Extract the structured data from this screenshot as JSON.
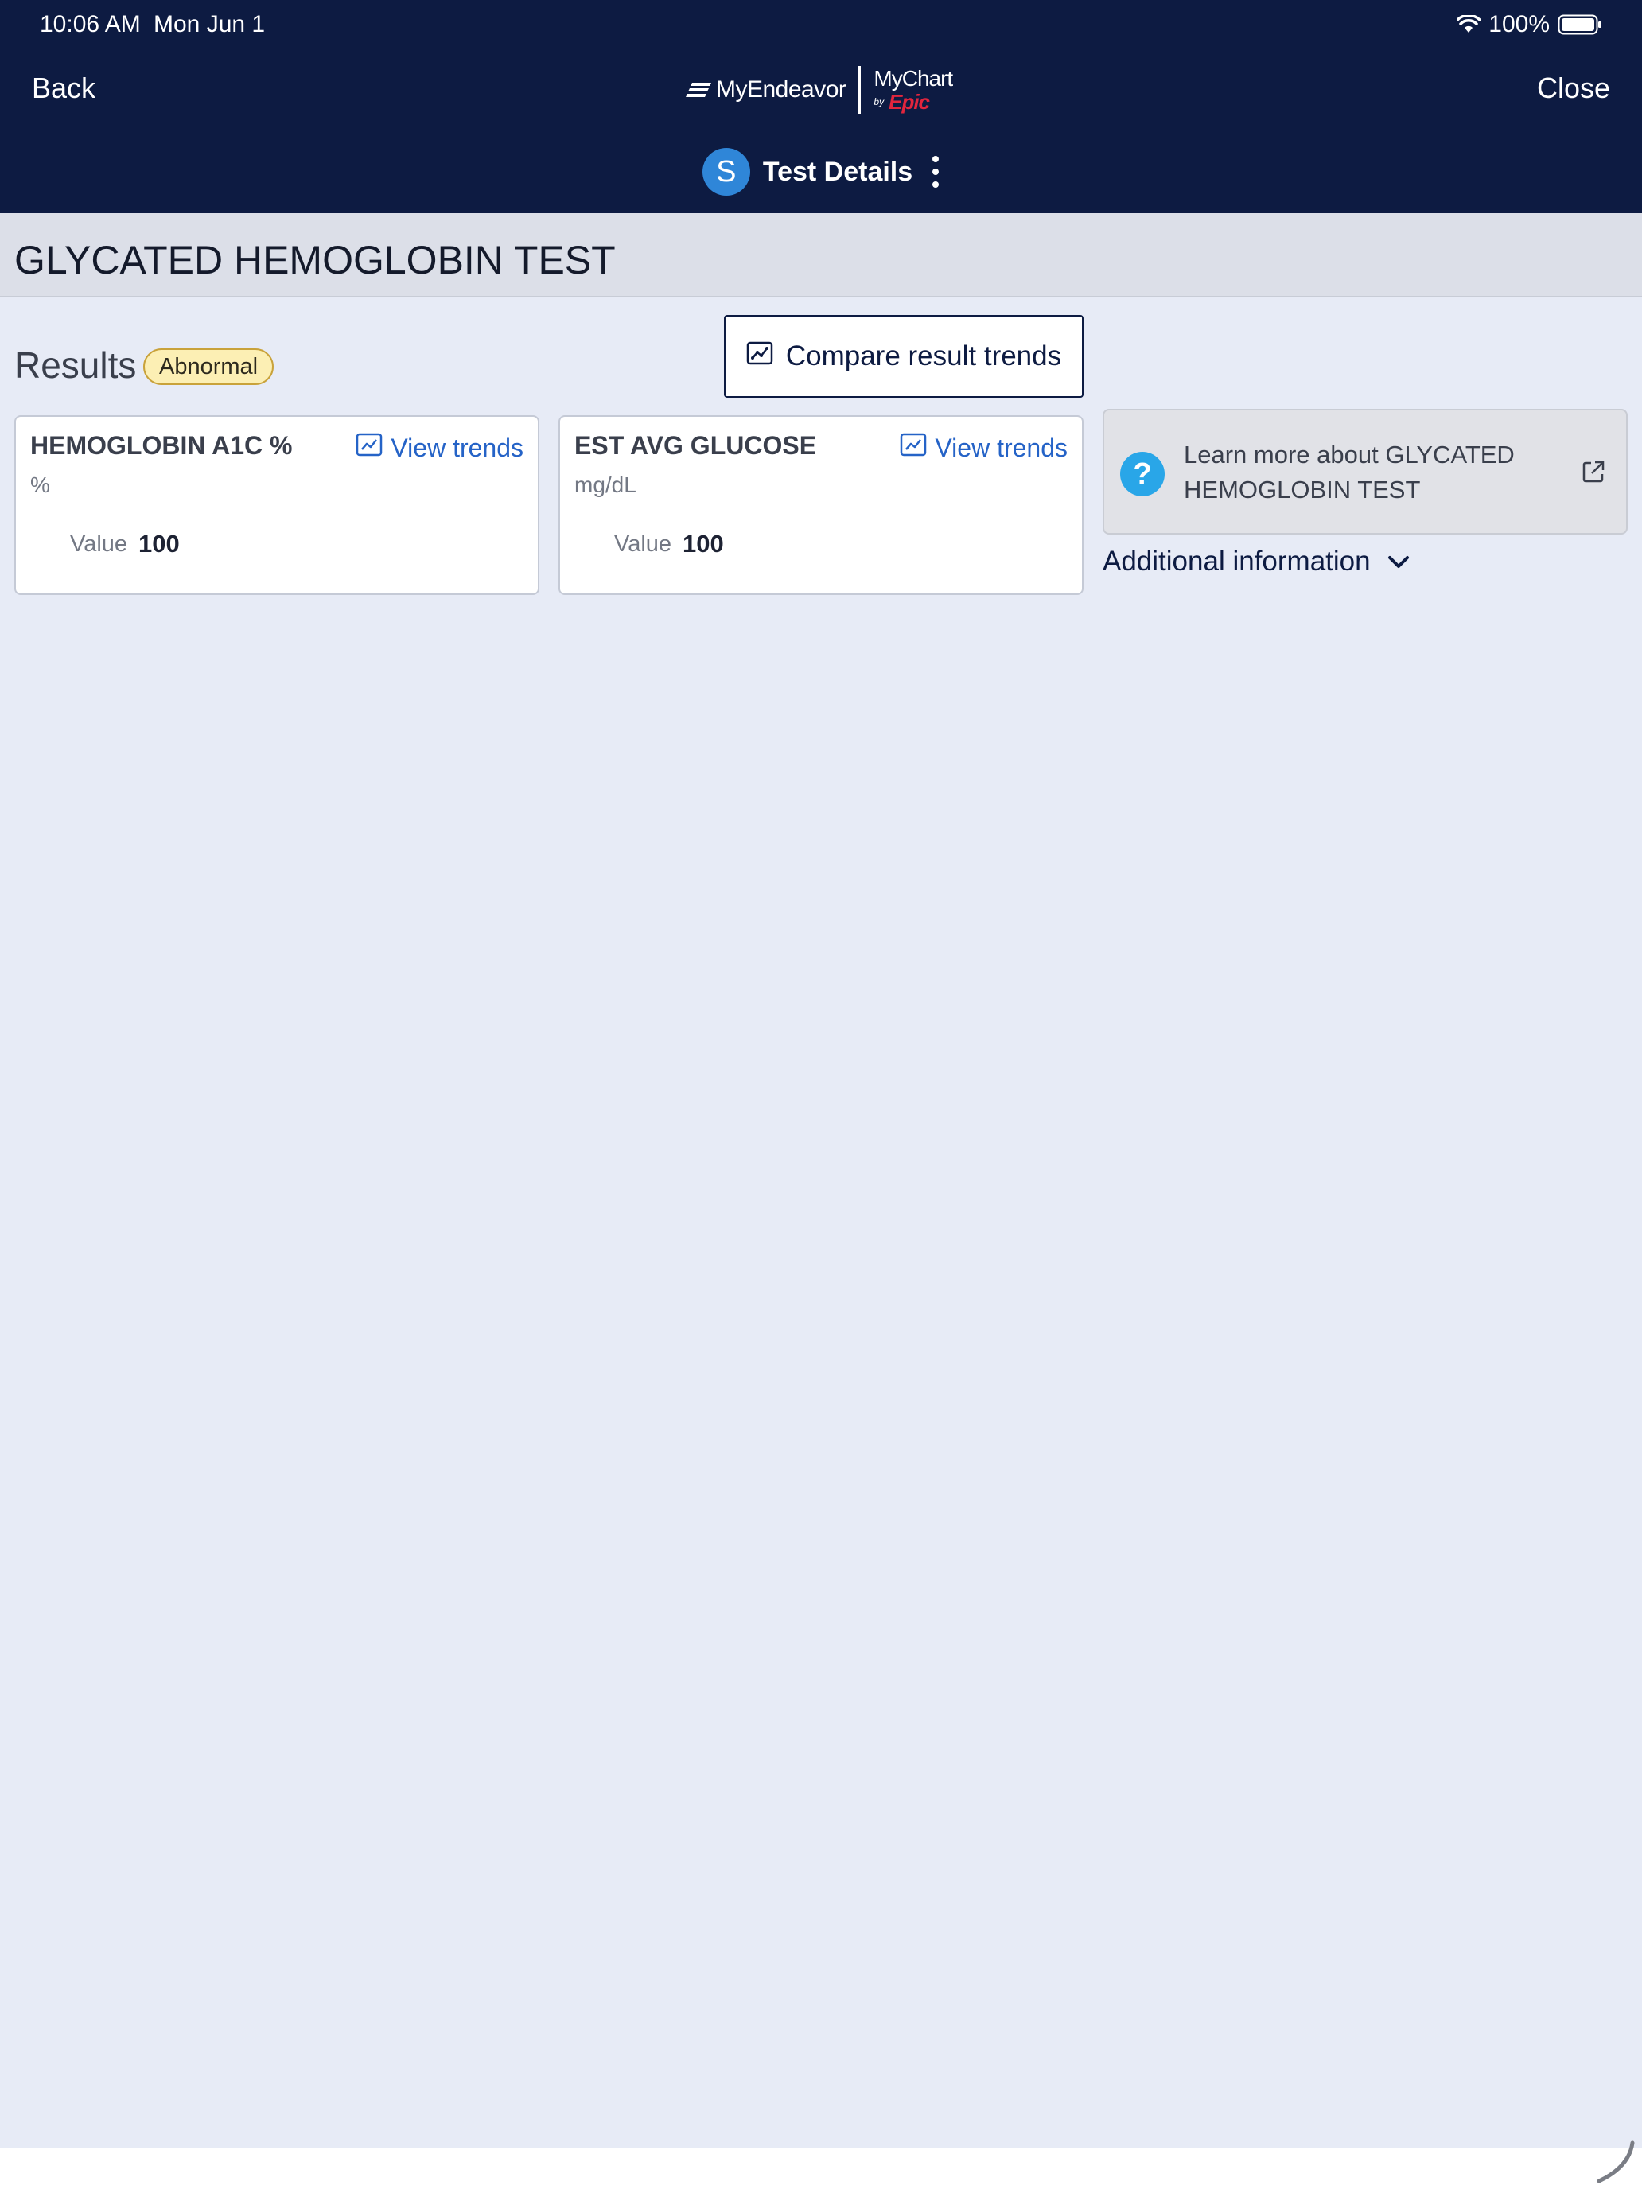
{
  "status_bar": {
    "time": "10:06 AM",
    "date": "Mon Jun 1",
    "battery": "100%"
  },
  "nav": {
    "back_label": "Back",
    "close_label": "Close",
    "logo": {
      "brand": "MyEndeavor",
      "mychart": "MyChart",
      "by": "by",
      "epic": "Epic"
    },
    "title": "Test Details",
    "avatar_initial": "S"
  },
  "page": {
    "title": "GLYCATED HEMOGLOBIN TEST"
  },
  "results": {
    "label": "Results",
    "badge": "Abnormal",
    "compare_label": "Compare result trends",
    "cards": [
      {
        "name": "HEMOGLOBIN A1C %",
        "trends_label": "View trends",
        "unit": "%",
        "value_label": "Value",
        "value": "100"
      },
      {
        "name": "EST AVG GLUCOSE",
        "trends_label": "View trends",
        "unit": "mg/dL",
        "value_label": "Value",
        "value": "100"
      }
    ]
  },
  "learn_more": {
    "text": "Learn more about GLYCATED HEMOGLOBIN TEST"
  },
  "additional_info": {
    "label": "Additional information"
  },
  "colors": {
    "header_bg": "#0d1b42",
    "page_bg": "#e7ebf6",
    "link": "#2563c7",
    "badge_bg": "#fcefb4",
    "epic_red": "#e2253d",
    "help_blue": "#29a6e8"
  }
}
